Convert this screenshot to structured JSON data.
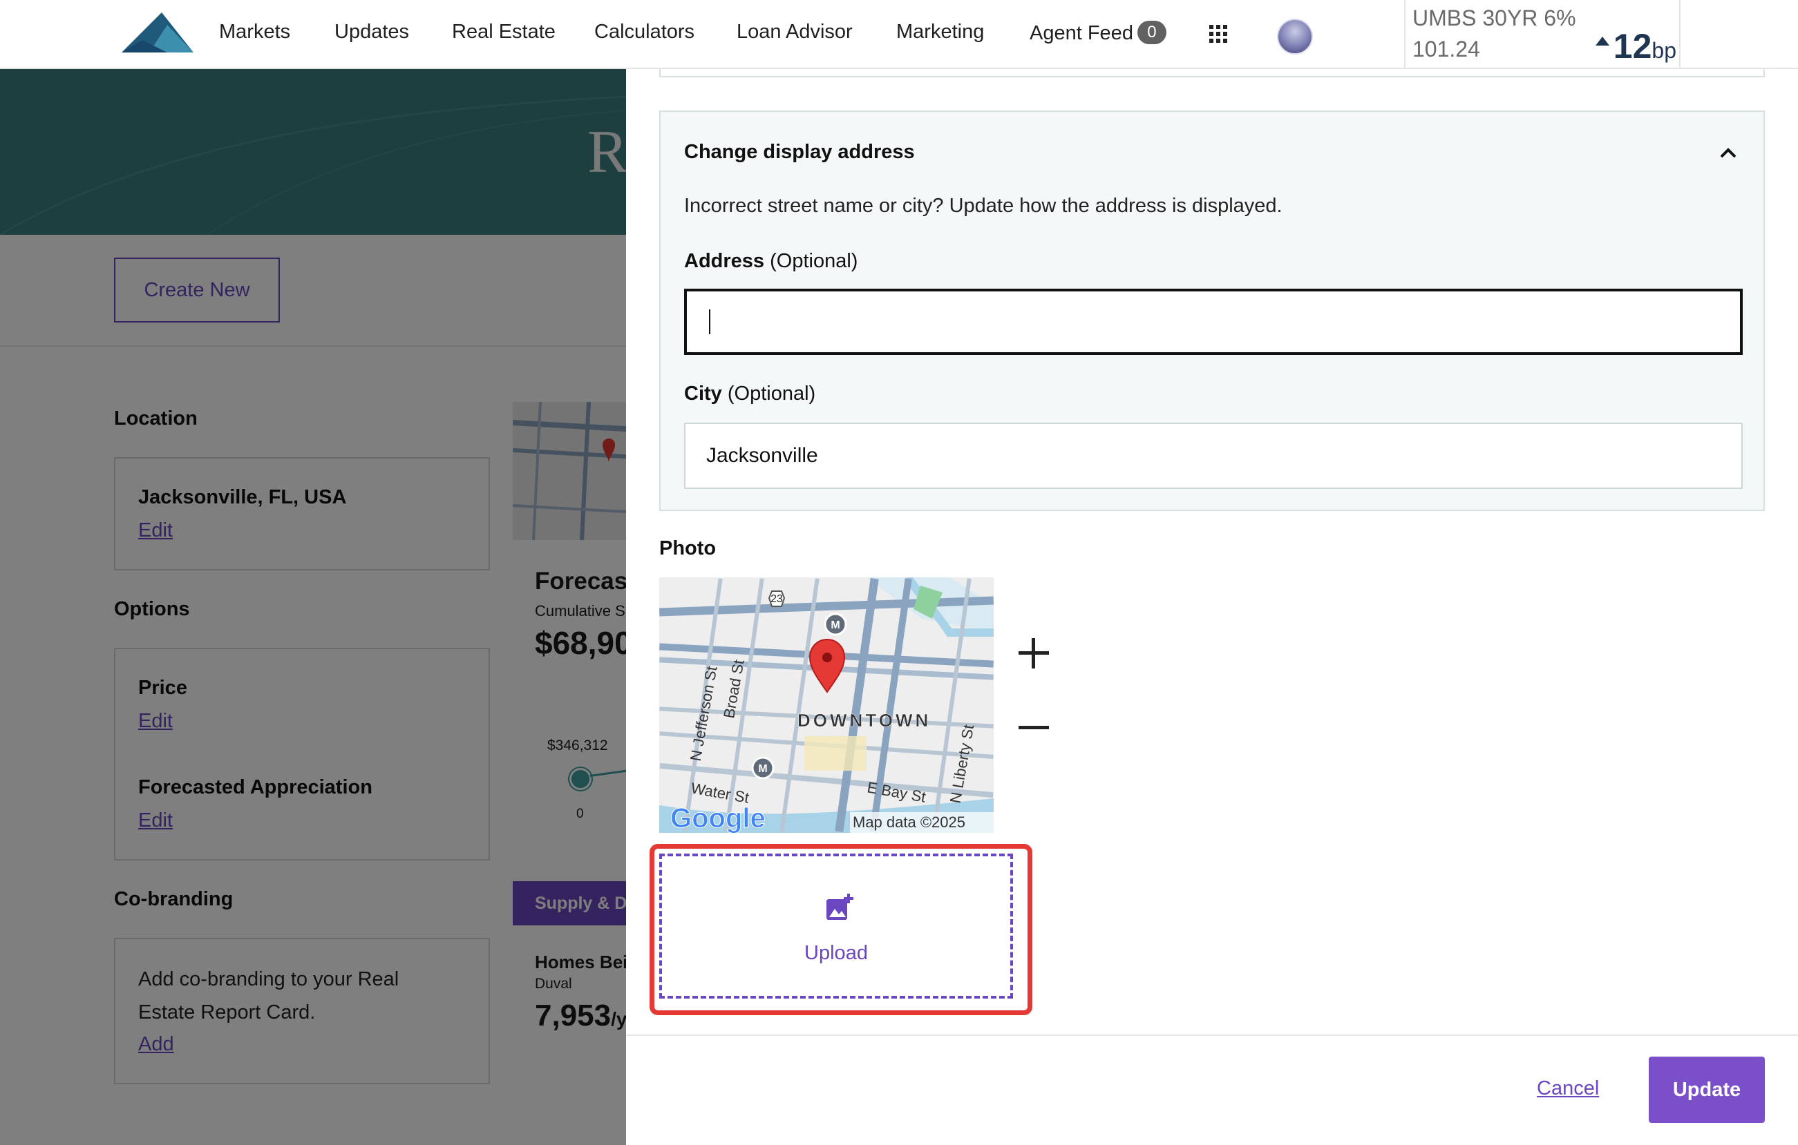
{
  "nav": {
    "items": [
      "Markets",
      "Updates",
      "Real Estate",
      "Calculators",
      "Loan Advisor",
      "Marketing",
      "Agent Feed"
    ],
    "agent_feed_badge": "0",
    "icons": [
      "logo-mountain-icon",
      "apps-grid-icon",
      "user-avatar"
    ]
  },
  "ticker": {
    "name": "UMBS 30YR 6%",
    "price": "101.24",
    "change_value": "12",
    "change_unit": "bp",
    "direction": "up"
  },
  "background_page": {
    "hero_letter": "R",
    "create_new": "Create New",
    "sections": {
      "location": {
        "heading": "Location",
        "value": "Jacksonville, FL, USA",
        "edit": "Edit"
      },
      "options": {
        "heading": "Options",
        "price": "Price",
        "price_edit": "Edit",
        "appreciation": "Forecasted Appreciation",
        "appreciation_edit": "Edit"
      },
      "cobranding": {
        "heading": "Co-branding",
        "text": "Add co-branding to your Real Estate Report Card.",
        "add": "Add"
      }
    },
    "preview": {
      "forecast_title": "Forecas",
      "forecast_sub": "Cumulative S",
      "forecast_value": "$68,90",
      "spark_label": "$346,312",
      "spark_axis": "0",
      "supply_tab": "Supply & D",
      "homes_title": "Homes Bei",
      "homes_sub": "Duval",
      "homes_value": "7,953",
      "homes_unit": "/y"
    }
  },
  "drawer": {
    "display_address": {
      "title": "Change display address",
      "description": "Incorrect street name or city? Update how the address is displayed.",
      "address_label": "Address",
      "address_optional": "(Optional)",
      "address_value": "",
      "city_label": "City",
      "city_optional": "(Optional)",
      "city_value": "Jacksonville"
    },
    "photo": {
      "label": "Photo",
      "map": {
        "route_shield": "23",
        "metro_marker": "M",
        "streets": [
          "N Jefferson St",
          "Broad St",
          "N Liberty St",
          "Water St",
          "E Bay St"
        ],
        "district": "DOWNTOWN",
        "attribution_logo": "Google",
        "attribution": "Map data ©2025"
      },
      "zoom_in": "+",
      "zoom_out": "−",
      "upload_label": "Upload"
    },
    "footer": {
      "cancel": "Cancel",
      "update": "Update"
    }
  },
  "colors": {
    "accent_purple": "#6b46c1",
    "update_button": "#7b4fc9",
    "hero_teal": "#3d7f80",
    "highlight_red": "#e53935",
    "ticker_navy": "#1f3552"
  }
}
